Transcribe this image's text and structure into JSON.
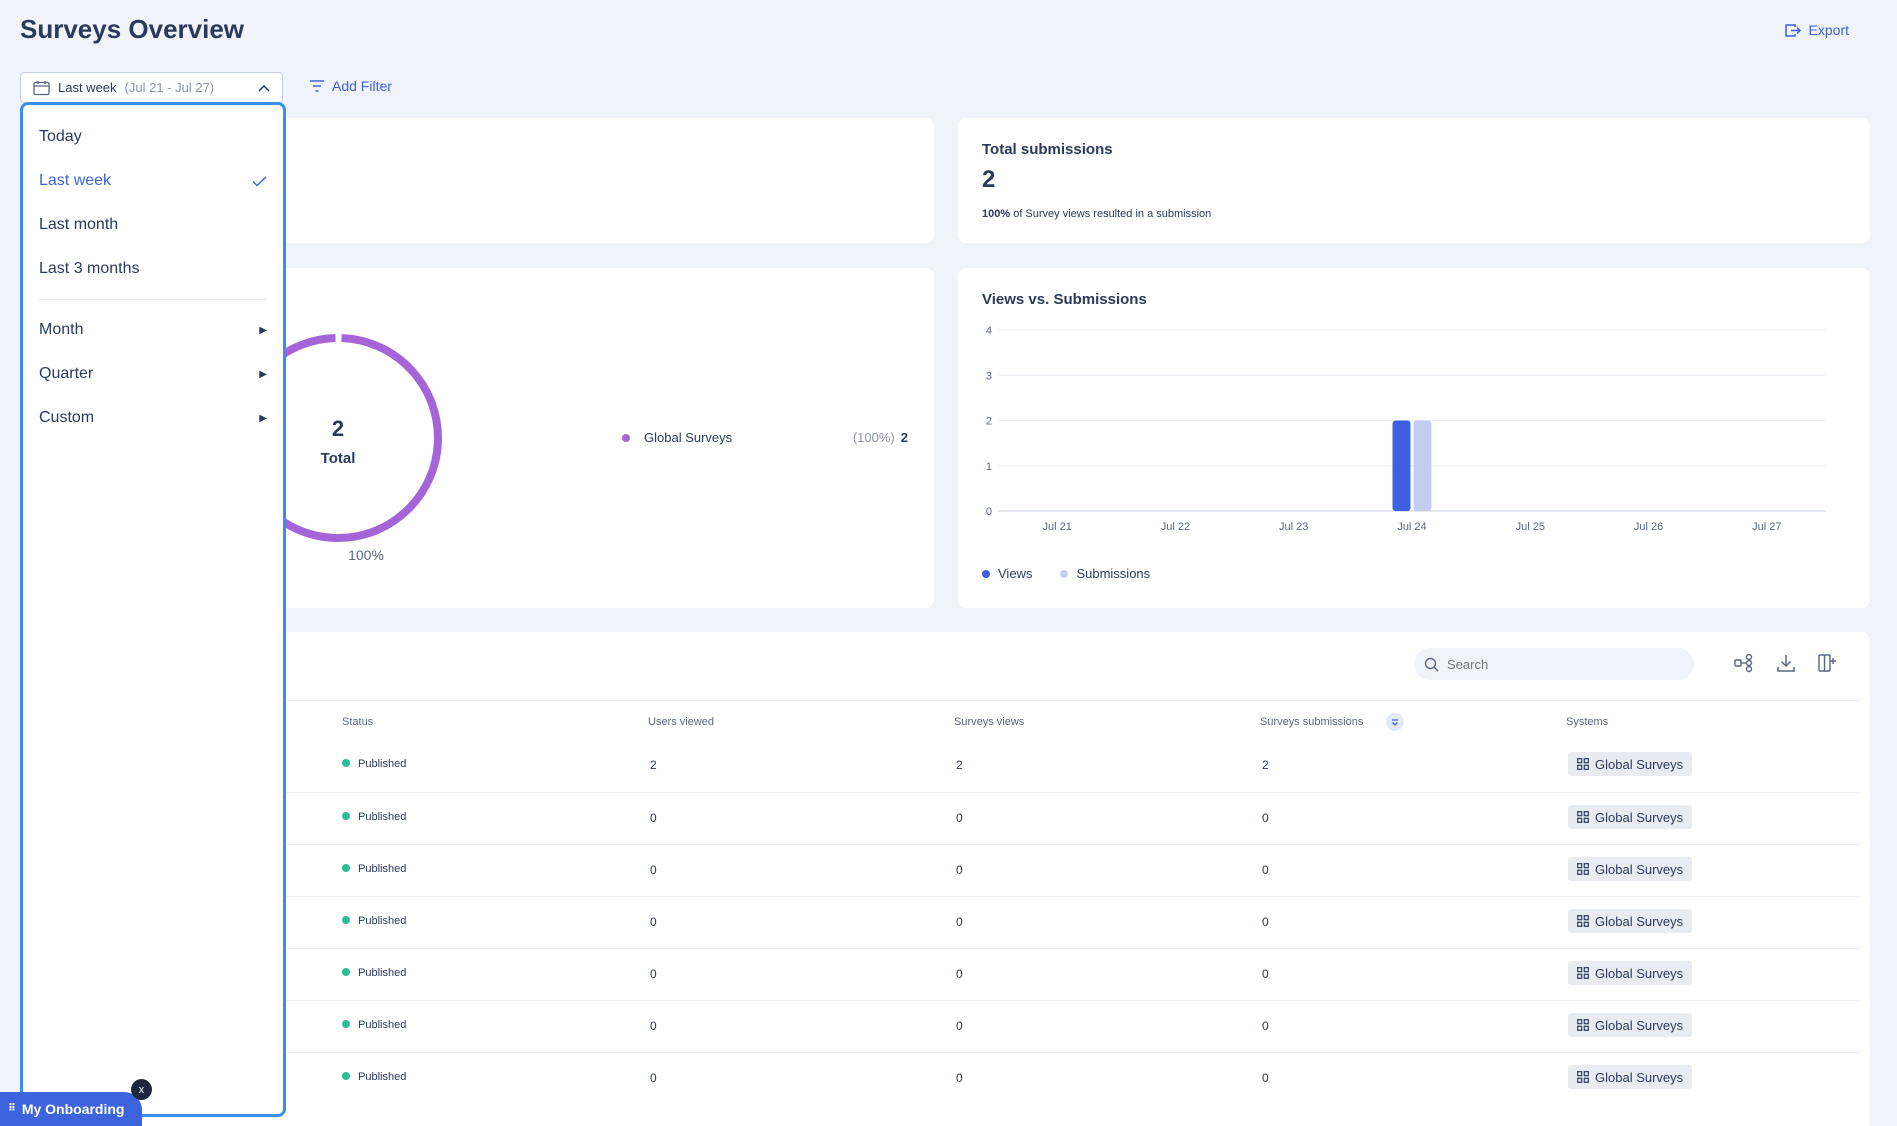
{
  "header": {
    "title": "Surveys Overview",
    "export_label": "Export"
  },
  "filters": {
    "date_range_label": "Last week",
    "date_range_sub": "(Jul 21 - Jul 27)",
    "add_filter_label": "Add Filter"
  },
  "dropdown": {
    "items": [
      {
        "label": "Today"
      },
      {
        "label": "Last week",
        "selected": true
      },
      {
        "label": "Last month"
      },
      {
        "label": "Last 3 months"
      }
    ],
    "submenus": [
      {
        "label": "Month"
      },
      {
        "label": "Quarter"
      },
      {
        "label": "Custom"
      }
    ]
  },
  "total_submissions": {
    "title": "Total submissions",
    "value": "2",
    "note_strong": "100%",
    "note_rest": "of Survey views resulted in a submission"
  },
  "donut": {
    "center_value": "2",
    "center_label": "Total",
    "percent_label": "100%",
    "legend": [
      {
        "name": "Global Surveys",
        "pct": "(100%)",
        "value": "2",
        "color": "#a565d8"
      }
    ]
  },
  "chart_data": {
    "type": "bar",
    "title": "Views vs. Submissions",
    "categories": [
      "Jul 21",
      "Jul 22",
      "Jul 23",
      "Jul 24",
      "Jul 25",
      "Jul 26",
      "Jul 27"
    ],
    "series": [
      {
        "name": "Views",
        "values": [
          0,
          0,
          0,
          2,
          0,
          0,
          0
        ],
        "color": "#3d5fe0"
      },
      {
        "name": "Submissions",
        "values": [
          0,
          0,
          0,
          2,
          0,
          0,
          0
        ],
        "color": "#c3cdf0"
      }
    ],
    "yticks": [
      "0",
      "1",
      "2",
      "3",
      "4"
    ],
    "ylim": [
      0,
      4
    ],
    "legend": "bottom-left"
  },
  "table": {
    "search_placeholder": "Search",
    "columns": [
      "Status",
      "Users viewed",
      "Surveys views",
      "Surveys submissions",
      "Systems"
    ],
    "rows": [
      {
        "status": "Published",
        "users_viewed": "2",
        "views": "2",
        "submissions": "2",
        "system": "Global Surveys"
      },
      {
        "status": "Published",
        "users_viewed": "0",
        "views": "0",
        "submissions": "0",
        "system": "Global Surveys"
      },
      {
        "status": "Published",
        "users_viewed": "0",
        "views": "0",
        "submissions": "0",
        "system": "Global Surveys"
      },
      {
        "status": "Published",
        "users_viewed": "0",
        "views": "0",
        "submissions": "0",
        "system": "Global Surveys"
      },
      {
        "status": "Published",
        "users_viewed": "0",
        "views": "0",
        "submissions": "0",
        "system": "Global Surveys"
      },
      {
        "status": "Published",
        "users_viewed": "0",
        "views": "0",
        "submissions": "0",
        "system": "Global Surveys"
      },
      {
        "status": "Published",
        "users_viewed": "0",
        "views": "0",
        "submissions": "0",
        "system": "Global Surveys"
      }
    ]
  },
  "onboarding": {
    "label": "My Onboarding",
    "close_label": "x"
  },
  "colors": {
    "accent": "#3d63dd",
    "dropdown_border": "#3b8ef0",
    "published": "#2ebb9a",
    "donut": "#a565d8"
  }
}
